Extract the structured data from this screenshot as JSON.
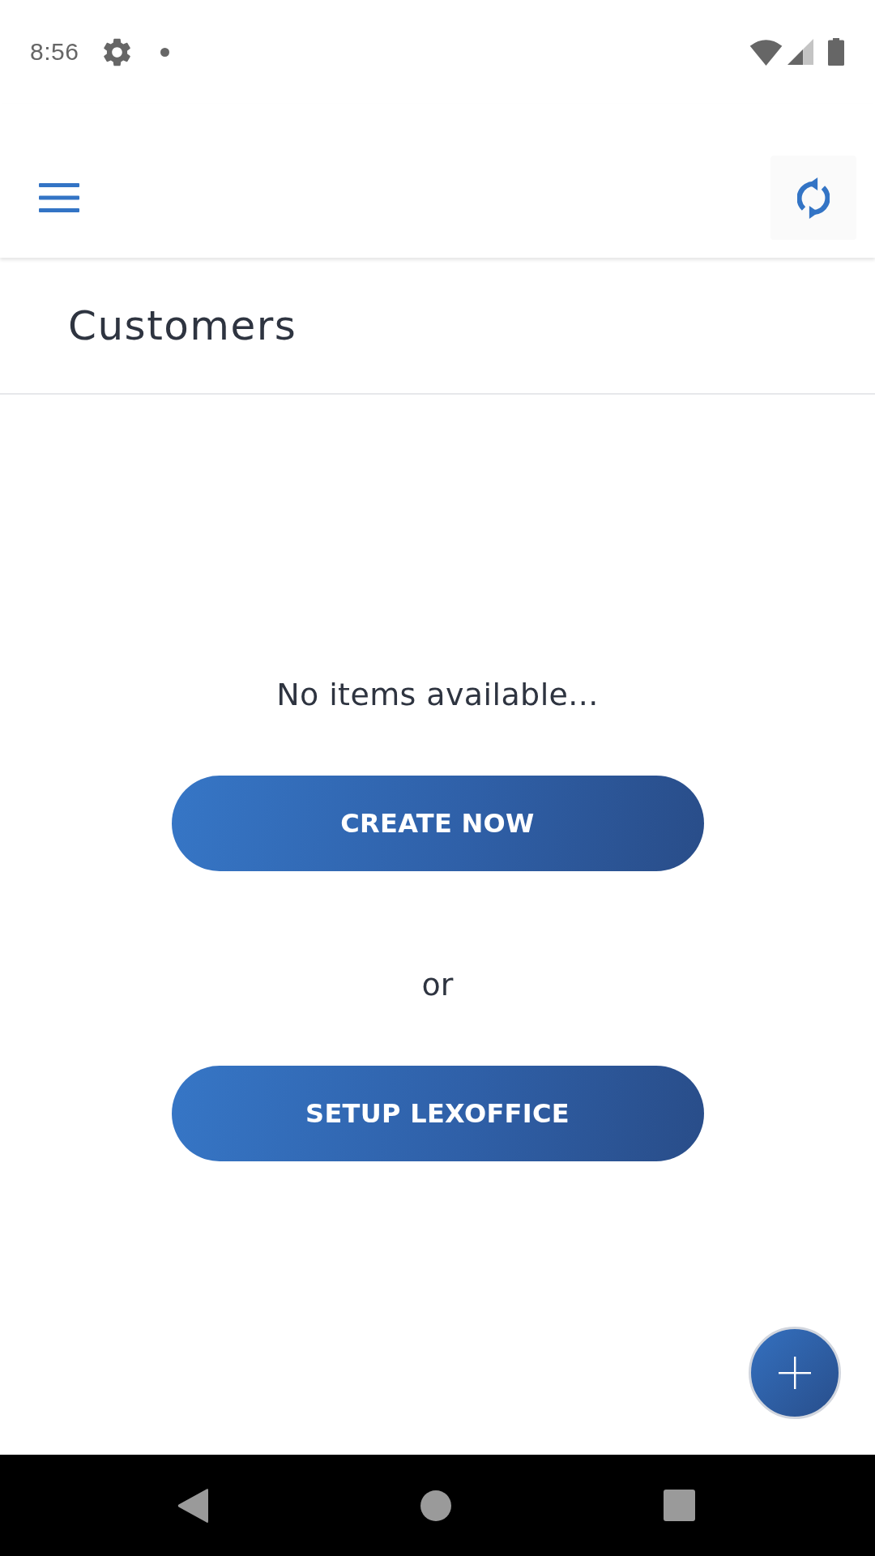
{
  "status_bar": {
    "time": "8:56"
  },
  "page": {
    "title": "Customers"
  },
  "empty_state": {
    "message": "No items available...",
    "separator": "or",
    "actions": [
      {
        "label": "CREATE NOW"
      },
      {
        "label": "SETUP LEXOFFICE"
      }
    ]
  }
}
